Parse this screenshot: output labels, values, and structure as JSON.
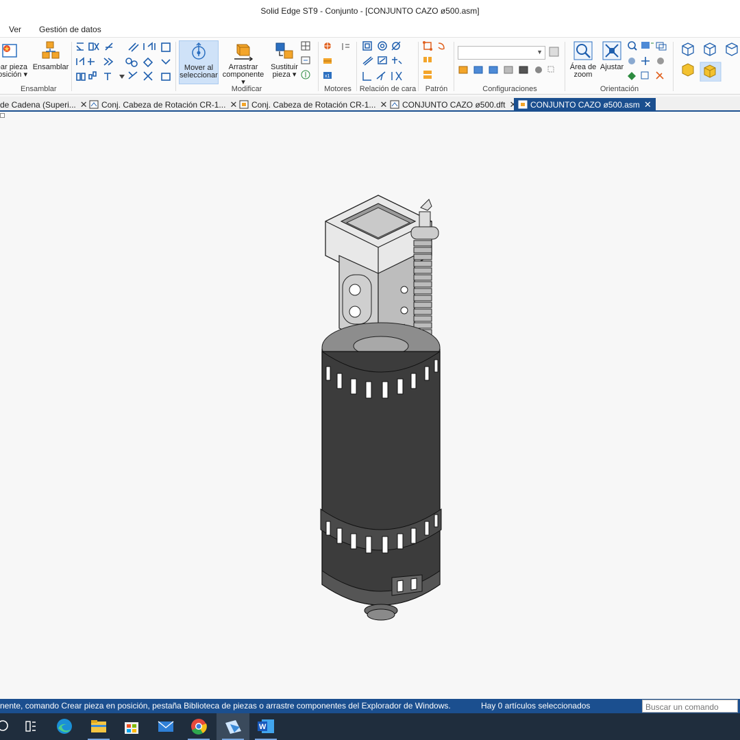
{
  "window": {
    "title": "Solid Edge ST9 - Conjunto - [CONJUNTO CAZO ø500.asm]"
  },
  "menu": {
    "items": [
      "Ver",
      "Gestión de datos"
    ]
  },
  "ribbon": {
    "groups": {
      "ensamblar": {
        "label": "Ensamblar",
        "create_part": "Crear pieza en posición",
        "assemble": "Ensamblar"
      },
      "modificar": {
        "label": "Modificar",
        "move_to_select": "Mover al seleccionar",
        "drag_component": "Arrastrar componente",
        "replace_part": "Sustituir pieza"
      },
      "motores": {
        "label": "Motores"
      },
      "relacion_cara": {
        "label": "Relación de cara"
      },
      "patron": {
        "label": "Patrón"
      },
      "configuraciones": {
        "label": "Configuraciones",
        "combo_value": ""
      },
      "orientacion": {
        "label": "Orientación",
        "zoom_area": "Área de zoom",
        "fit": "Ajustar"
      }
    }
  },
  "tabs": [
    {
      "label": "de Cadena (Superi...",
      "type": "asm",
      "active": false
    },
    {
      "label": "Conj. Cabeza de Rotación CR-1...",
      "type": "dft",
      "active": false
    },
    {
      "label": "Conj. Cabeza de Rotación CR-1...",
      "type": "asm",
      "active": false
    },
    {
      "label": "CONJUNTO CAZO ø500.dft",
      "type": "dft",
      "active": false
    },
    {
      "label": "CONJUNTO CAZO ø500.asm",
      "type": "asm",
      "active": true
    }
  ],
  "status": {
    "message": "nente, comando Crear pieza en posición, pestaña Biblioteca de piezas o arrastre componentes del Explorador de Windows.",
    "selection": "Hay 0 artículos seleccionados",
    "command_placeholder": "Buscar un comando"
  },
  "taskbar": {
    "apps": [
      "search-icon",
      "task-view-icon",
      "edge-icon",
      "file-explorer-icon",
      "store-icon",
      "mail-icon",
      "chrome-icon",
      "solid-edge-icon",
      "word-icon"
    ],
    "active": "solid-edge-icon"
  },
  "colors": {
    "accent": "#1b4f8f",
    "ribbon_active": "#cfe2f8",
    "taskbar": "#1f2d3d",
    "model_dark": "#3c3c3c",
    "model_light": "#d8d8d8"
  }
}
